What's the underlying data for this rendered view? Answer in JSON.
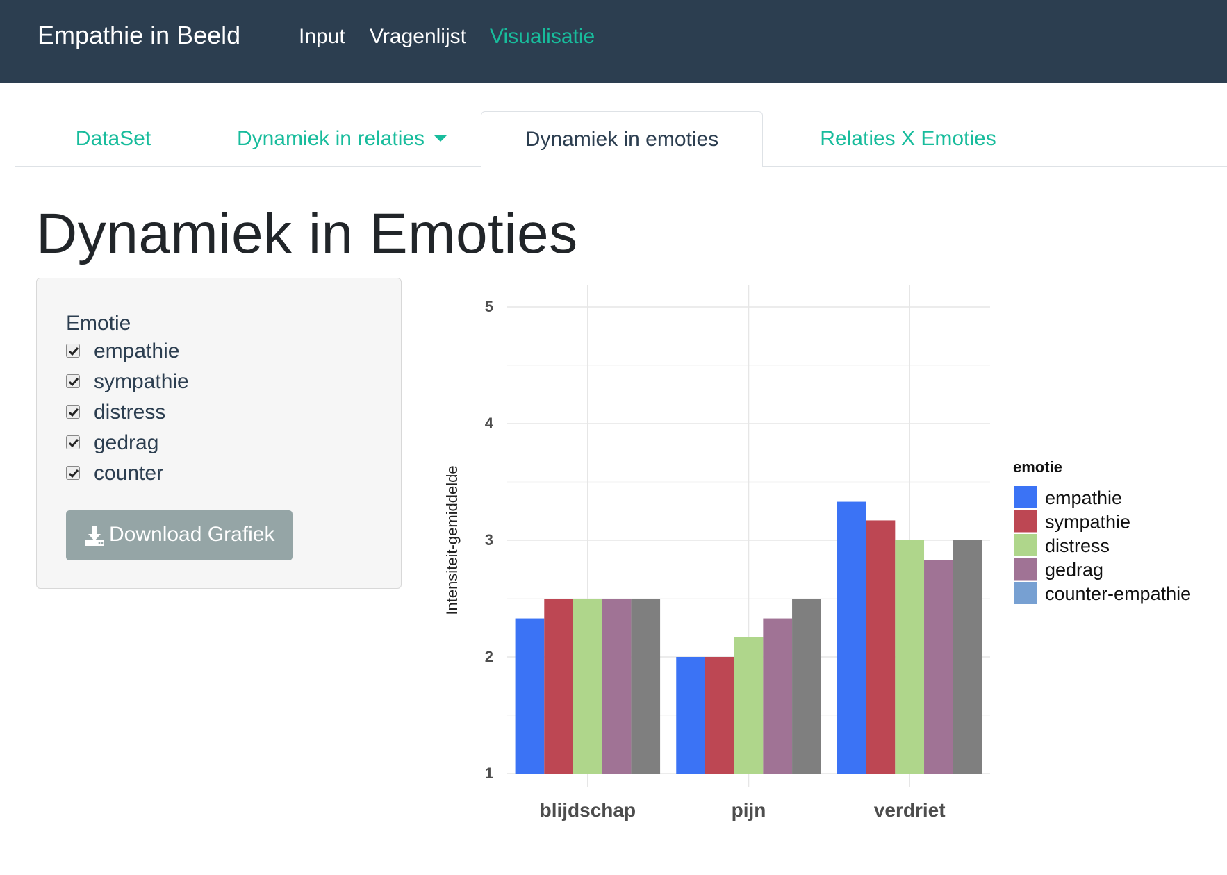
{
  "navbar": {
    "brand": "Empathie in Beeld",
    "links": [
      "Input",
      "Vragenlijst",
      "Visualisatie"
    ],
    "active_link": "Visualisatie"
  },
  "tabs": [
    {
      "label": "DataSet"
    },
    {
      "label": "Dynamiek in relaties"
    },
    {
      "label": "Dynamiek in emoties"
    },
    {
      "label": "Relaties X Emoties"
    }
  ],
  "active_tab": "Dynamiek in emoties",
  "page_title": "Dynamiek in Emoties",
  "sidebar": {
    "group_label": "Emotie",
    "checkboxes": [
      {
        "label": "empathie",
        "checked": true
      },
      {
        "label": "sympathie",
        "checked": true
      },
      {
        "label": "distress",
        "checked": true
      },
      {
        "label": "gedrag",
        "checked": true
      },
      {
        "label": "counter",
        "checked": true
      }
    ],
    "download_label": "Download Grafiek",
    "download_icon": "download-icon"
  },
  "colors": {
    "navbar_bg": "#2c3e50",
    "accent": "#18bc9c",
    "button_bg": "#95a5a6"
  },
  "chart_data": {
    "type": "bar",
    "categories": [
      "blijdschap",
      "pijn",
      "verdriet"
    ],
    "series": [
      {
        "name": "empathie",
        "color": "#3b73f5",
        "values": [
          2.33,
          2.0,
          3.33
        ]
      },
      {
        "name": "sympathie",
        "color": "#bd4753",
        "values": [
          2.5,
          2.0,
          3.17
        ]
      },
      {
        "name": "distress",
        "color": "#afd68b",
        "values": [
          2.5,
          2.17,
          3.0
        ]
      },
      {
        "name": "gedrag",
        "color": "#a07395",
        "values": [
          2.5,
          2.33,
          2.83
        ]
      },
      {
        "name": "counter-empathie",
        "color": "#7f7f7f",
        "legend_color": "#77a0d2",
        "values": [
          2.5,
          2.5,
          3.0
        ]
      }
    ],
    "legend_title": "emotie",
    "legend_position": "right",
    "ylabel": "Intensiteit-gemiddelde",
    "xlabel": "",
    "ylim": [
      1,
      5
    ],
    "yticks": [
      "1",
      "2",
      "3",
      "4",
      "5"
    ],
    "grid": true
  }
}
